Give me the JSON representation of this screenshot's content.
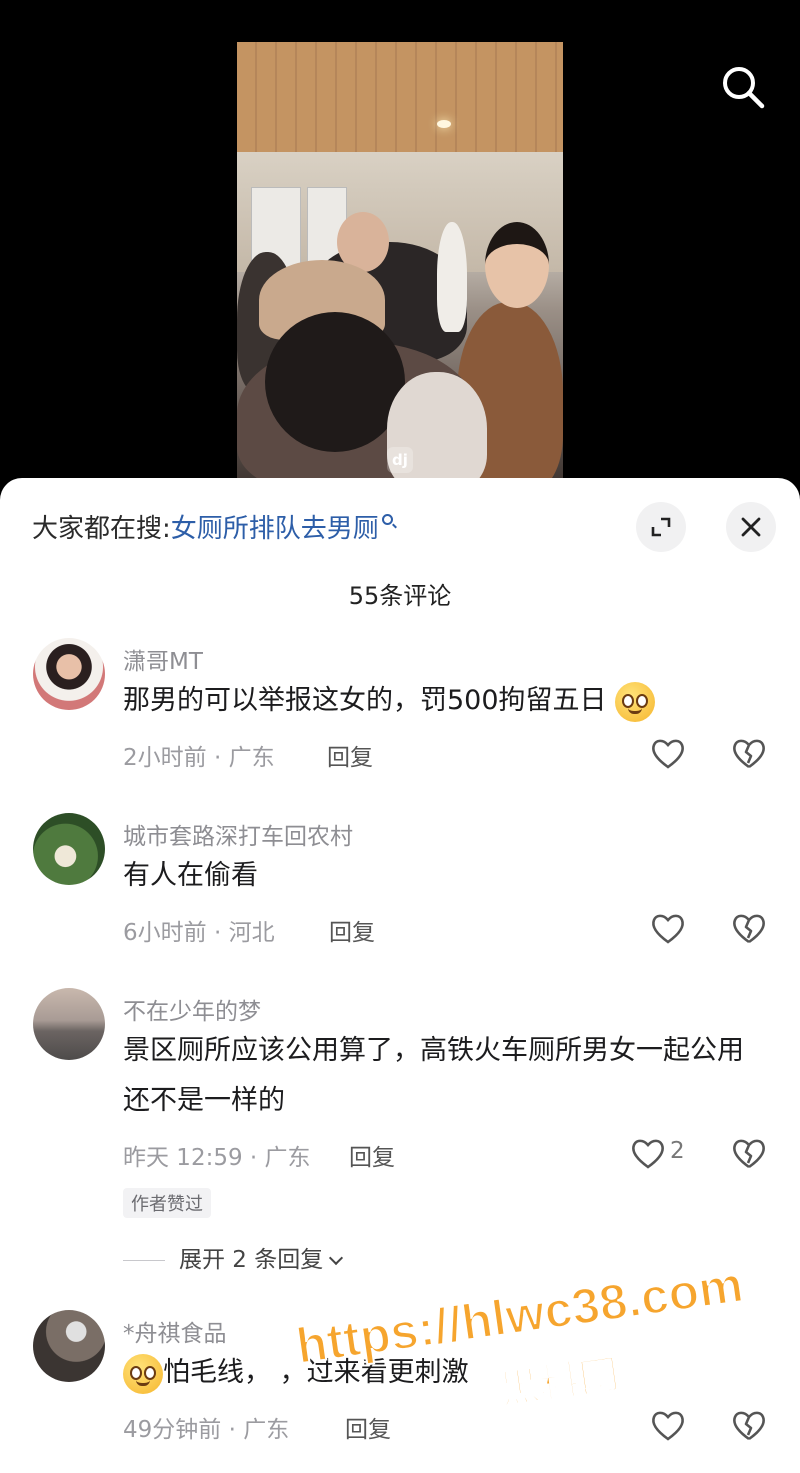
{
  "search_hint": {
    "prefix": "大家都在搜:",
    "term": "女厕所排队去男厕"
  },
  "comment_count_label": "55条评论",
  "video": {
    "overlay_logo": "dj"
  },
  "comments": [
    {
      "username": "潇哥MT",
      "text": "那男的可以举报这女的，罚500拘留五日",
      "time_location": "2小时前 · 广东",
      "reply_label": "回复",
      "likes": ""
    },
    {
      "username": "城市套路深打车回农村",
      "text": "有人在偷看",
      "time_location": "6小时前 · 河北",
      "reply_label": "回复",
      "likes": ""
    },
    {
      "username": "不在少年的梦",
      "text": "景区厕所应该公用算了，高铁火车厕所男女一起公用还不是一样的",
      "time_location": "昨天 12:59 · 广东",
      "reply_label": "回复",
      "likes": "2",
      "author_badge": "作者赞过",
      "expand_replies": "展开 2 条回复"
    },
    {
      "username": "*舟祺食品",
      "text": "怕毛线，    ，过来看更刺激",
      "time_location": "49分钟前 · 广东",
      "reply_label": "回复",
      "likes": ""
    }
  ],
  "watermark": {
    "url": "https://hlwc38.com",
    "label": "黑料网"
  },
  "colors": {
    "accent_link": "#2d5ea8",
    "watermark": "#f6a52e"
  }
}
